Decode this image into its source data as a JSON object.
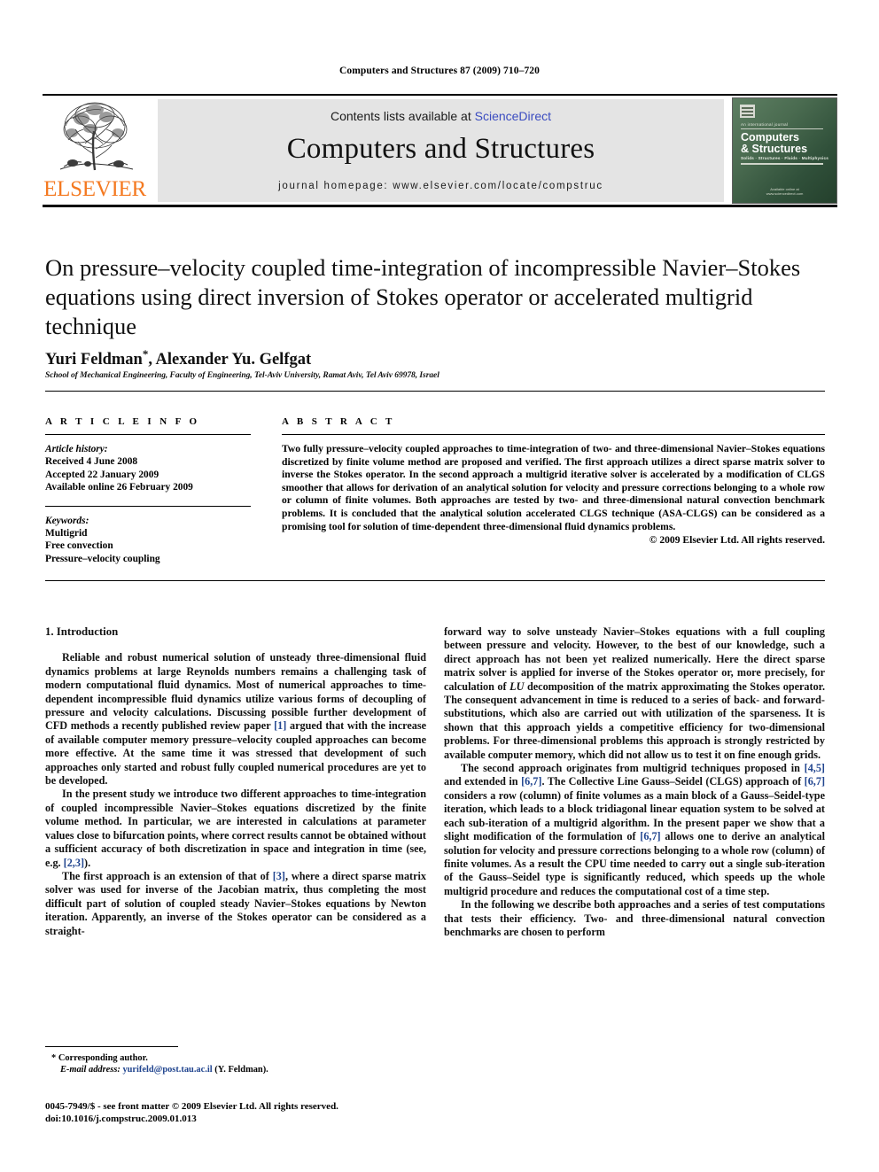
{
  "running_head": "Computers and Structures 87 (2009) 710–720",
  "masthead": {
    "contents_prefix": "Contents lists available at ",
    "sciencedirect": "ScienceDirect",
    "journal_title": "Computers and Structures",
    "homepage": "journal homepage: www.elsevier.com/locate/compstruc",
    "publisher_wordmark": "ELSEVIER",
    "publisher_logo_icon": "elsevier-tree-icon",
    "link_color": "#3b4cc0",
    "wordmark_color": "#F47920",
    "banner_bg": "#e4e4e4",
    "cover": {
      "kicker": "An international journal",
      "title_line1": "Computers",
      "title_line2": "& Structures",
      "subtitle": "Solids · Structures · Fluids · Multiphysics",
      "footer_line1": "Available online at",
      "footer_line2": "www.sciencedirect.com"
    }
  },
  "article": {
    "title": "On pressure–velocity coupled time-integration of incompressible Navier–Stokes equations using direct inversion of Stokes operator or accelerated multigrid technique",
    "authors": "Yuri Feldman",
    "authors_tail": ", Alexander Yu. Gelfgat",
    "corresponding_marker": "*",
    "affiliation": "School of Mechanical Engineering, Faculty of Engineering, Tel-Aviv University, Ramat Aviv, Tel Aviv 69978, Israel"
  },
  "info": {
    "heading": "A R T I C L E   I N F O",
    "history_label": "Article history:",
    "history": [
      "Received 4 June 2008",
      "Accepted 22 January 2009",
      "Available online 26 February 2009"
    ],
    "keywords_label": "Keywords:",
    "keywords": [
      "Multigrid",
      "Free convection",
      "Pressure–velocity coupling"
    ]
  },
  "abstract": {
    "heading": "A B S T R A C T",
    "text": "Two fully pressure–velocity coupled approaches to time-integration of two- and three-dimensional Navier–Stokes equations discretized by finite volume method are proposed and verified. The first approach utilizes a direct sparse matrix solver to inverse the Stokes operator. In the second approach a multigrid iterative solver is accelerated by a modification of CLGS smoother that allows for derivation of an analytical solution for velocity and pressure corrections belonging to a whole row or column of finite volumes. Both approaches are tested by two- and three-dimensional natural convection benchmark problems. It is concluded that the analytical solution accelerated CLGS technique (ASA-CLGS) can be considered as a promising tool for solution of time-dependent three-dimensional fluid dynamics problems.",
    "copyright": "© 2009 Elsevier Ltd. All rights reserved."
  },
  "body": {
    "section_heading": "1. Introduction",
    "left_p1_a": "Reliable and robust numerical solution of unsteady three-dimensional fluid dynamics problems at large Reynolds numbers remains a challenging task of modern computational fluid dynamics. Most of numerical approaches to time-dependent incompressible fluid dynamics utilize various forms of decoupling of pressure and velocity calculations. Discussing possible further development of CFD methods a recently published review paper ",
    "left_p1_ref": "[1]",
    "left_p1_b": " argued that with the increase of available computer memory pressure–velocity coupled approaches can become more effective. At the same time it was stressed that development of such approaches only started and robust fully coupled numerical procedures are yet to be developed.",
    "left_p2_a": "In the present study we introduce two different approaches to time-integration of coupled incompressible Navier–Stokes equations discretized by the finite volume method. In particular, we are interested in calculations at parameter values close to bifurcation points, where correct results cannot be obtained without a sufficient accuracy of both discretization in space and integration in time (see, e.g. ",
    "left_p2_ref": "[2,3]",
    "left_p2_b": ").",
    "left_p3_a": "The first approach is an extension of that of ",
    "left_p3_ref": "[3]",
    "left_p3_b": ", where a direct sparse matrix solver was used for inverse of the Jacobian matrix, thus completing the most difficult part of solution of coupled steady Navier–Stokes equations by Newton iteration. Apparently, an inverse of the Stokes operator can be considered as a straight-",
    "right_p1_a": "forward way to solve unsteady Navier–Stokes equations with a full coupling between pressure and velocity. However, to the best of our knowledge, such a direct approach has not been yet realized numerically. Here the direct sparse matrix solver is applied for inverse of the Stokes operator or, more precisely, for calculation of ",
    "right_p1_it": "LU",
    "right_p1_b": " decomposition of the matrix approximating the Stokes operator. The consequent advancement in time is reduced to a series of back- and forward-substitutions, which also are carried out with utilization of the sparseness. It is shown that this approach yields a competitive efficiency for two-dimensional problems. For three-dimensional problems this approach is strongly restricted by available computer memory, which did not allow us to test it on fine enough grids.",
    "right_p2_a": "The second approach originates from multigrid techniques proposed in ",
    "right_p2_ref1": "[4,5]",
    "right_p2_b": " and extended in ",
    "right_p2_ref2": "[6,7]",
    "right_p2_c": ". The Collective Line Gauss–Seidel (CLGS) approach of ",
    "right_p2_ref3": "[6,7]",
    "right_p2_d": " considers a row (column) of finite volumes as a main block of a Gauss–Seidel-type iteration, which leads to a block tridiagonal linear equation system to be solved at each sub-iteration of a multigrid algorithm. In the present paper we show that a slight modification of the formulation of ",
    "right_p2_ref4": "[6,7]",
    "right_p2_e": " allows one to derive an analytical solution for velocity and pressure corrections belonging to a whole row (column) of finite volumes. As a result the CPU time needed to carry out a single sub-iteration of the Gauss–Seidel type is significantly reduced, which speeds up the whole multigrid procedure and reduces the computational cost of a time step.",
    "right_p3": "In the following we describe both approaches and a series of test computations that tests their efficiency. Two- and three-dimensional natural convection benchmarks are chosen to perform",
    "reference_link_color": "#21458f"
  },
  "footnote": {
    "corresponding_marker": "*",
    "corresponding_text": "Corresponding author.",
    "email_label": "E-mail address:",
    "email": "yurifeld@post.tau.ac.il",
    "email_owner": "(Y. Feldman)."
  },
  "footer": {
    "issn_line": "0045-7949/$ - see front matter © 2009 Elsevier Ltd. All rights reserved.",
    "doi_line": "doi:10.1016/j.compstruc.2009.01.013"
  }
}
